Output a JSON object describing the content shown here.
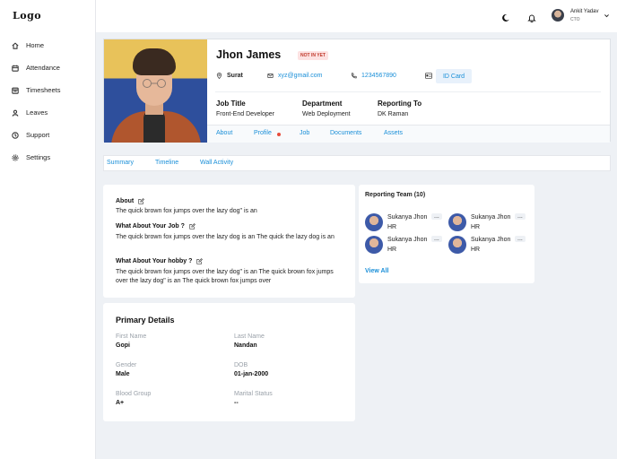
{
  "app": {
    "logo": "Logo"
  },
  "sidebar": {
    "items": [
      {
        "label": "Home",
        "icon": "home-icon"
      },
      {
        "label": "Attendance",
        "icon": "calendar-icon"
      },
      {
        "label": "Timesheets",
        "icon": "timesheet-icon"
      },
      {
        "label": "Leaves",
        "icon": "user-icon"
      },
      {
        "label": "Support",
        "icon": "support-icon"
      },
      {
        "label": "Settings",
        "icon": "gear-icon"
      }
    ]
  },
  "topbar": {
    "user_name": "Ankit Yadav",
    "user_role": "CTO"
  },
  "profile": {
    "name": "Jhon James",
    "status": "NOT IN YET",
    "location": "Surat",
    "email": "xyz@gmail.com",
    "phone": "1234567890",
    "id_card_label": "ID Card",
    "meta": [
      {
        "label": "Job Title",
        "value": "Front-End Developer"
      },
      {
        "label": "Department",
        "value": "Web Deployment"
      },
      {
        "label": "Reporting To",
        "value": "DK Raman"
      }
    ],
    "tabs": [
      "About",
      "Profile",
      "Job",
      "Documents",
      "Assets"
    ]
  },
  "subtabs": [
    "Summary",
    "Timeline",
    "Wall Activity"
  ],
  "about": {
    "sections": [
      {
        "heading": "About",
        "text": "The quick brown fox jumps over the lazy dog\" is an"
      },
      {
        "heading": "What About Your Job ?",
        "text": "The quick brown fox jumps over the lazy dog is an The quick the lazy dog is an"
      },
      {
        "heading": "What About Your hobby ?",
        "text": "The quick brown fox jumps over the lazy dog\" is an The quick brown fox jumps over the lazy dog\" is an The quick brown fox jumps over"
      }
    ]
  },
  "team": {
    "title": "Reporting Team (10)",
    "members": [
      {
        "name": "Sukanya Jhon",
        "role": "HR",
        "more": "..."
      },
      {
        "name": "Sukanya Jhon",
        "role": "HR",
        "more": "..."
      },
      {
        "name": "Sukanya Jhon",
        "role": "HR",
        "more": "..."
      },
      {
        "name": "Sukanya Jhon",
        "role": "HR",
        "more": "..."
      }
    ],
    "view_all": "View All"
  },
  "details": {
    "title": "Primary Details",
    "fields": [
      {
        "label": "First Name",
        "value": "Gopi"
      },
      {
        "label": "Last Name",
        "value": "Nandan"
      },
      {
        "label": "Gender",
        "value": "Male"
      },
      {
        "label": "DOB",
        "value": "01-jan-2000"
      },
      {
        "label": "Blood Group",
        "value": "A+"
      },
      {
        "label": "Marital Status",
        "value": "--"
      }
    ]
  },
  "colors": {
    "accent": "#1a8fd8",
    "status": "#c0392b",
    "background": "#eef1f5"
  }
}
